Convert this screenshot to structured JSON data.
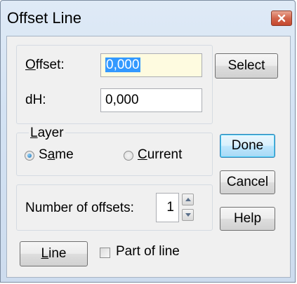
{
  "window": {
    "title": "Offset Line"
  },
  "offset": {
    "label": "Offset:",
    "label_hotkey": "O",
    "label_rest": "ffset:",
    "value": "0,000",
    "select_label": "Select"
  },
  "dh": {
    "label": "dH:",
    "value": "0,000"
  },
  "layer": {
    "group_label": "Layer",
    "group_hotkey": "L",
    "group_rest": "ayer",
    "same": {
      "label": "Same",
      "pre": "S",
      "hotkey": "a",
      "post": "me",
      "checked": true
    },
    "current": {
      "label": "Current",
      "hotkey": "C",
      "post": "urrent",
      "checked": false
    }
  },
  "offsets": {
    "label": "Number of offsets:",
    "value": "1"
  },
  "buttons": {
    "done": "Done",
    "cancel": "Cancel",
    "help": "Help"
  },
  "line": {
    "label": "Line",
    "hotkey": "L",
    "rest": "ine"
  },
  "part_of_line": {
    "label": "Part of line",
    "checked": false
  },
  "icons": [
    "close-icon",
    "spin-up-icon",
    "spin-down-icon"
  ],
  "colors": {
    "title_bar": "#d3e2f3",
    "default_button": "#3c7fb1",
    "close_button": "#c4472f",
    "selection": "#3399ff"
  }
}
